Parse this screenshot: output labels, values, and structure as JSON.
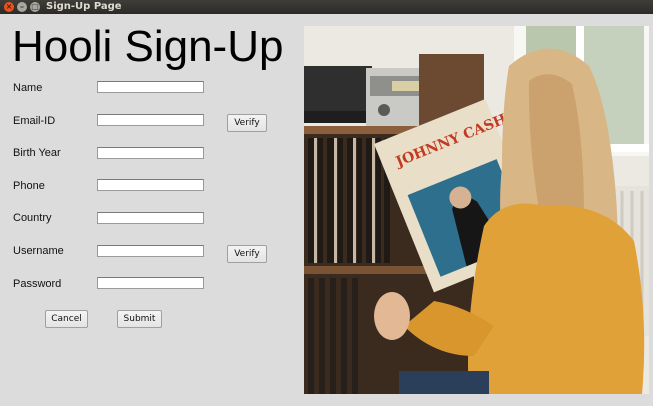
{
  "window": {
    "title": "Sign-Up Page",
    "close_glyph": "×",
    "min_glyph": "–",
    "max_glyph": "□"
  },
  "heading": "Hooli Sign-Up",
  "form": {
    "name_label": "Name",
    "email_label": "Email-ID",
    "birth_label": "Birth Year",
    "phone_label": "Phone",
    "country_label": "Country",
    "username_label": "Username",
    "password_label": "Password",
    "name_value": "",
    "email_value": "",
    "birth_value": "",
    "phone_value": "",
    "country_value": "",
    "username_value": "",
    "password_value": ""
  },
  "buttons": {
    "verify_email": "Verify",
    "verify_username": "Verify",
    "cancel": "Cancel",
    "submit": "Submit"
  },
  "photo": {
    "album_title": "JOHNNY CASH",
    "colors": {
      "sweater": "#e0a238",
      "hair": "#d9b685",
      "wall": "#ece9e3",
      "shelf": "#4a3322"
    }
  }
}
